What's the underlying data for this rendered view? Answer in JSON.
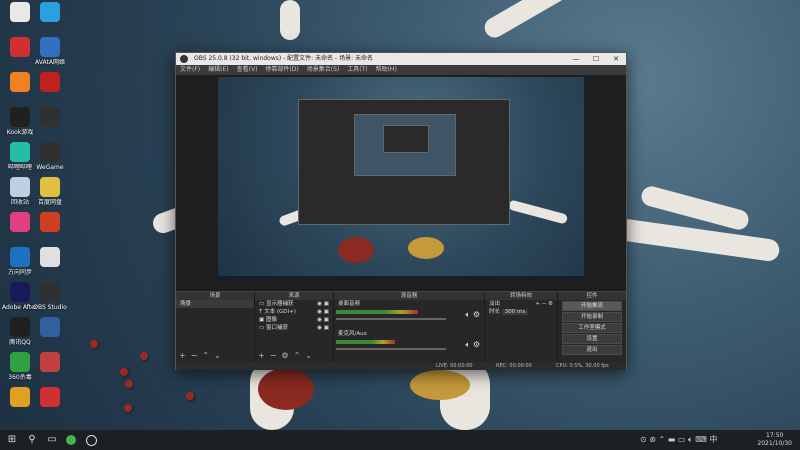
{
  "desktop": {
    "icons": [
      {
        "label": "",
        "color": "#e8e8e8"
      },
      {
        "label": "",
        "color": "#2aa0e0"
      },
      {
        "label": "",
        "color": "#d03030"
      },
      {
        "label": "AVAtA网络",
        "color": "#3070c0"
      },
      {
        "label": "",
        "color": "#f08020"
      },
      {
        "label": "",
        "color": "#c02020"
      },
      {
        "label": "Kook游戏",
        "color": "#202020"
      },
      {
        "label": "",
        "color": "#303030"
      },
      {
        "label": "哔哩哔哩",
        "color": "#20c0a0"
      },
      {
        "label": "WeGame",
        "color": "#303030"
      },
      {
        "label": "回收站",
        "color": "#c0d0e0"
      },
      {
        "label": "百度网盘",
        "color": "#e0c040"
      },
      {
        "label": "",
        "color": "#e04080"
      },
      {
        "label": "",
        "color": "#d04020"
      },
      {
        "label": "方向同步",
        "color": "#2070c0"
      },
      {
        "label": "",
        "color": "#e0e0e0"
      },
      {
        "label": "Adobe After Effects CC...",
        "color": "#1a1a5a"
      },
      {
        "label": "OBS Studio",
        "color": "#303030"
      },
      {
        "label": "腾讯QQ",
        "color": "#202020"
      },
      {
        "label": "",
        "color": "#3060a0"
      },
      {
        "label": "360杀毒",
        "color": "#30a040"
      },
      {
        "label": "",
        "color": "#c04040"
      },
      {
        "label": "",
        "color": "#e0a020"
      },
      {
        "label": "",
        "color": "#d03030"
      }
    ]
  },
  "obs": {
    "title": "OBS 25.0.8 (32 bit, windows) - 配置文件: 未命名 - 场景: 未命名",
    "window_controls": [
      "—",
      "☐",
      "✕"
    ],
    "menu": [
      "文件(F)",
      "编辑(E)",
      "查看(V)",
      "停靠部件(D)",
      "场景集合(S)",
      "工具(T)",
      "帮助(H)"
    ],
    "docks": {
      "scenes": {
        "title": "场景",
        "items": [
          "场景"
        ]
      },
      "sources": {
        "title": "来源",
        "items": [
          "显示器捕获",
          "文本 (GDI+)",
          "图像",
          "窗口捕获"
        ]
      },
      "mixer": {
        "title": "混音器",
        "channels": [
          {
            "name": "桌面音频",
            "level": 0.63
          },
          {
            "name": "麦克风/Aux",
            "level": 0.45
          }
        ]
      },
      "transitions": {
        "title": "转场特效",
        "type": "淡出",
        "duration_label": "时长",
        "duration": "300 ms"
      },
      "controls": {
        "title": "控件",
        "buttons": [
          "开始推流",
          "开始录制",
          "工作室模式",
          "设置",
          "退出"
        ]
      }
    },
    "status": {
      "live": "LIVE: 00:00:00",
      "rec": "REC: 00:00:00",
      "cpu": "CPU: 0.5%, 30.00 fps"
    },
    "icons": [
      "add-icon",
      "remove-icon",
      "up-icon",
      "down-icon",
      "gear-icon",
      "eye-icon",
      "lock-icon",
      "speaker-icon"
    ]
  },
  "taskbar": {
    "time": "17:50",
    "date": "2021/10/30"
  }
}
